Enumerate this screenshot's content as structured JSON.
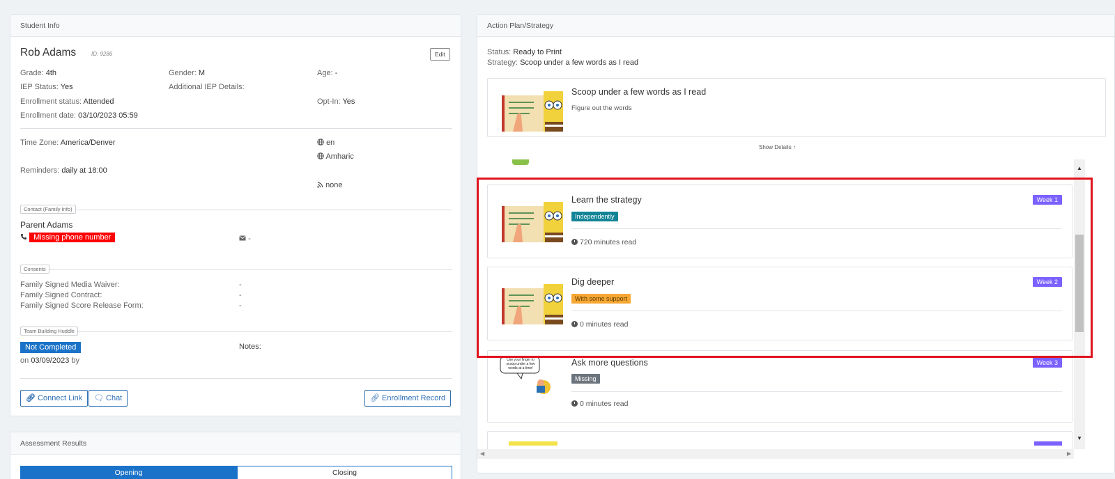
{
  "student_info": {
    "panel_title": "Student Info",
    "name": "Rob Adams",
    "id_label": "ID: 9286",
    "edit_label": "Edit",
    "grade_label": "Grade:",
    "grade": "4th",
    "gender_label": "Gender:",
    "gender": "M",
    "age_label": "Age:",
    "age": "-",
    "iep_label": "IEP Status:",
    "iep": "Yes",
    "iep_details_label": "Additional IEP Details:",
    "enrollment_status_label": "Enrollment status:",
    "enrollment_status": "Attended",
    "opt_in_label": "Opt-In:",
    "opt_in": "Yes",
    "enrollment_date_label": "Enrollment date:",
    "enrollment_date": "03/10/2023 05:59",
    "time_zone_label": "Time Zone:",
    "time_zone": "America/Denver",
    "language_1": "en",
    "language_2": "Amharic",
    "reminders_label": "Reminders:",
    "reminders": "daily at 18:00",
    "feed": "none",
    "contact_legend": "Contact (Family Info)",
    "parent_name": "Parent Adams",
    "missing_phone": "Missing phone number",
    "email": "-",
    "consents_legend": "Consents",
    "consents": [
      {
        "label": "Family Signed Media Waiver:",
        "value": "-"
      },
      {
        "label": "Family Signed Contract:",
        "value": "-"
      },
      {
        "label": "Family Signed Score Release Form:",
        "value": "-"
      }
    ],
    "huddle_legend": "Team Building Huddle",
    "huddle_status": "Not Completed",
    "huddle_on": "on",
    "huddle_date": "03/09/2023",
    "huddle_by": "by",
    "notes_label": "Notes:",
    "connect_link": "Connect Link",
    "chat": "Chat",
    "enrollment_record": "Enrollment Record"
  },
  "assessment": {
    "panel_title": "Assessment Results",
    "tab_opening": "Opening",
    "tab_closing": "Closing"
  },
  "action_plan": {
    "panel_title": "Action Plan/Strategy",
    "status_label": "Status:",
    "status": "Ready to Print",
    "strategy_label": "Strategy:",
    "strategy": "Scoop under a few words as I read",
    "main_card": {
      "title": "Scoop under a few words as I read",
      "subtitle": "Figure out the words"
    },
    "show_details": "Show Details",
    "cards": [
      {
        "title": "Learn the strategy",
        "badge": "Independently",
        "week": "Week 1",
        "minutes": "720 minutes read"
      },
      {
        "title": "Dig deeper",
        "badge": "With some support",
        "week": "Week 2",
        "minutes": "0 minutes read"
      },
      {
        "title": "Ask more questions",
        "badge": "Missing",
        "week": "Week 3",
        "minutes": "0 minutes read"
      }
    ],
    "thumb_caption": "Use your finger to scoop under a few words at a time!"
  },
  "colors": {
    "primary": "#2f6fb4",
    "danger": "#ff0000",
    "highlight_border": "#e0141e",
    "teal": "#138496",
    "orange": "#f7a733",
    "gray": "#6c757d",
    "purple": "#7b61ff"
  }
}
